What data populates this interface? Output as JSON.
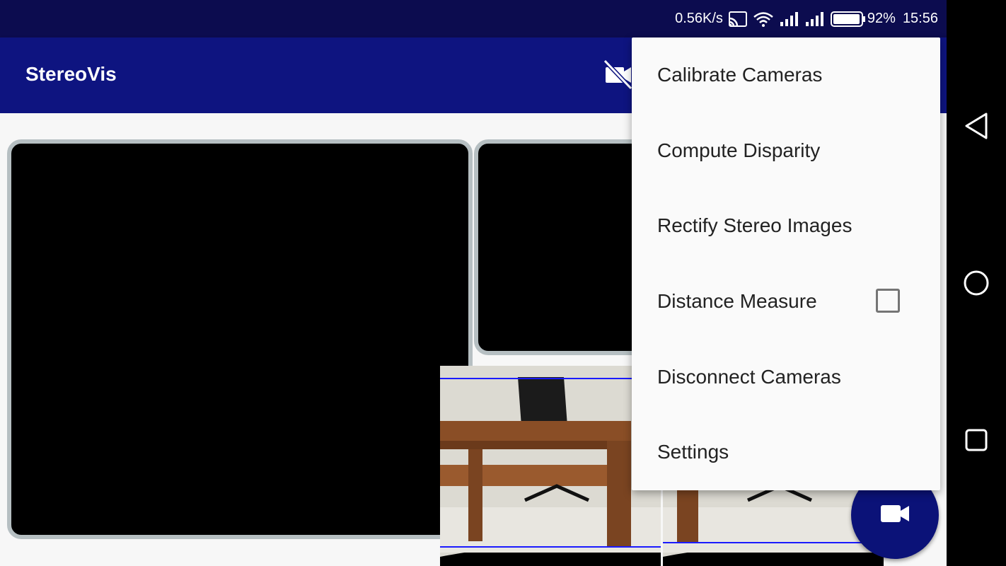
{
  "status_bar": {
    "net_speed": "0.56K/s",
    "battery": "92%",
    "time": "15:56",
    "icons": [
      "cast-icon",
      "wifi-icon",
      "signal-icon",
      "signal-icon",
      "battery-icon"
    ]
  },
  "app_bar": {
    "title": "StereoVis",
    "action_icon": "camera-off-icon"
  },
  "menu": {
    "items": [
      {
        "label": "Calibrate Cameras"
      },
      {
        "label": "Compute Disparity"
      },
      {
        "label": "Rectify Stereo Images"
      },
      {
        "label": "Distance Measure",
        "checkable": true,
        "checked": false
      },
      {
        "label": "Disconnect Cameras"
      },
      {
        "label": "Settings"
      }
    ]
  },
  "fab": {
    "icon": "videocam-icon"
  },
  "nav_bar": {
    "icons": [
      "back-icon",
      "home-icon",
      "recents-icon"
    ]
  },
  "colors": {
    "status_bar": "#0c0c4f",
    "app_bar": "#0e1480",
    "fab": "#0b1278",
    "menu_bg": "#fafafa",
    "pane_border": "#b6bfc2",
    "rectify_line": "#1a1aff"
  }
}
